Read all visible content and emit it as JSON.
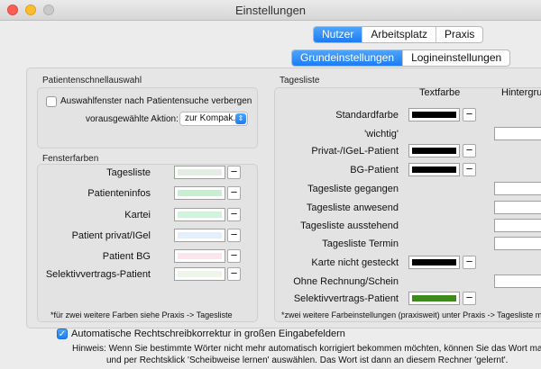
{
  "window": {
    "title": "Einstellungen"
  },
  "top_tabs": [
    "Nutzer",
    "Arbeitsplatz",
    "Praxis"
  ],
  "sub_tabs": [
    "Grundeinstellungen",
    "Logineinstellungen"
  ],
  "patientenschnellauswahl": {
    "group_label": "Patientenschnellauswahl",
    "checkbox_label": "Auswahlfenster nach Patientensuche verbergen",
    "checkbox_checked": false,
    "action_label": "vorausgewählte Aktion:",
    "action_value": "zur Kompak..."
  },
  "fensterfarben": {
    "group_label": "Fensterfarben",
    "rows": [
      {
        "label": "Tagesliste",
        "color": "#e4ece4"
      },
      {
        "label": "Patienteninfos",
        "color": "#c6f0d0"
      },
      {
        "label": "Kartei",
        "color": "#cdf6dc"
      },
      {
        "label": "Patient privat/IGel",
        "color": "#e4eefc"
      },
      {
        "label": "Patient BG",
        "color": "#fbe6ec"
      },
      {
        "label": "Selektivvertrags-Patient",
        "color": "#eef6ea"
      }
    ],
    "note": "*für zwei weitere Farben siehe Praxis -> Tagesliste"
  },
  "tagesliste": {
    "group_label": "Tagesliste",
    "col_text": "Textfarbe",
    "col_bg": "Hintergru",
    "rows": [
      {
        "label": "Standardfarbe",
        "text_color": "#000000"
      },
      {
        "label": "'wichtig'",
        "text_color": null
      },
      {
        "label": "Privat-/IGeL-Patient",
        "text_color": "#000000"
      },
      {
        "label": "BG-Patient",
        "text_color": "#000000"
      },
      {
        "label": "Tagesliste gegangen",
        "text_color": null
      },
      {
        "label": "Tagesliste anwesend",
        "text_color": null
      },
      {
        "label": "Tagesliste ausstehend",
        "text_color": null
      },
      {
        "label": "Tagesliste Termin",
        "text_color": null
      },
      {
        "label": "Karte nicht gesteckt",
        "text_color": "#000000"
      },
      {
        "label": "Ohne Rechnung/Schein",
        "text_color": null
      },
      {
        "label": "Selektivvertrags-Patient",
        "text_color": "#3f8a1f"
      }
    ],
    "note": "*zwei weitere Farbeinstellungen (praxisweit) unter Praxis -> Tagesliste mö"
  },
  "autocorrect": {
    "checked": true,
    "label": "Automatische Rechtschreibkorrektur in großen Eingabefeldern",
    "hint_line1": "Hinweis: Wenn Sie bestimmte Wörter nicht mehr automatisch korrigiert bekommen möchten, können Sie das Wort markieren",
    "hint_line2": "und per Rechtsklick 'Scheibweise lernen' auswählen. Das Wort ist dann an diesem Rechner 'gelernt'."
  }
}
